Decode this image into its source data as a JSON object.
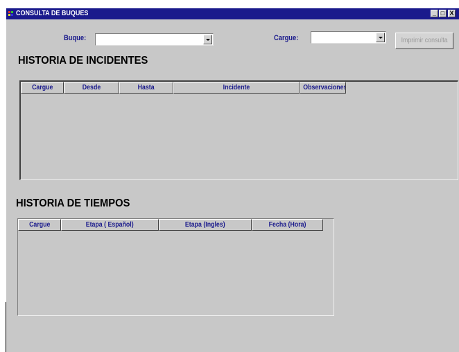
{
  "window": {
    "title": "CONSULTA DE BUQUES",
    "controls": [
      "_",
      "□",
      "X"
    ]
  },
  "filters": {
    "buque_label": "Buque:",
    "buque_value": "",
    "cargue_label": "Cargue:",
    "cargue_value": ""
  },
  "actions": {
    "print_label": "Imprimir consulta"
  },
  "incidentes": {
    "heading": "HISTORIA DE INCIDENTES",
    "columns": [
      "Cargue",
      "Desde",
      "Hasta",
      "Incidente",
      "Observaciones"
    ]
  },
  "tiempos": {
    "heading": "HISTORIA DE TIEMPOS",
    "columns": [
      "Cargue",
      "Etapa ( Español)",
      "Etapa (Ingles)",
      "Fecha (Hora)"
    ]
  },
  "colors": {
    "title_bar": "#1a1a8c",
    "label": "#1a1a8c",
    "background": "#c8c8c8"
  }
}
